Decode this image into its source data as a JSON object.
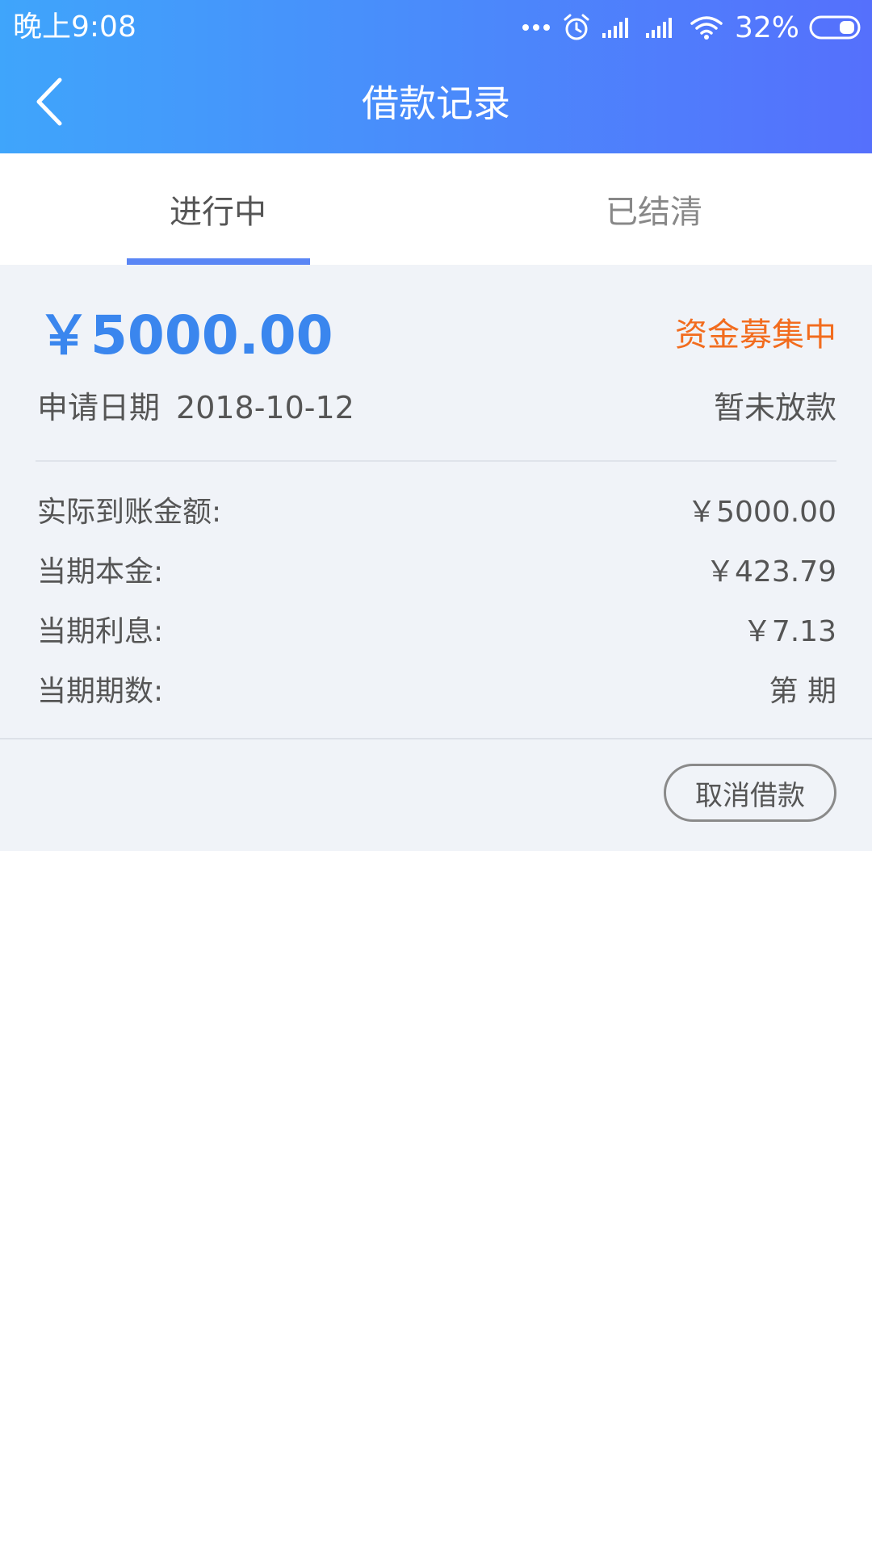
{
  "status_bar": {
    "time": "晚上9:08",
    "battery": "32%",
    "icons": [
      "more-dots-icon",
      "alarm-icon",
      "signal-icon",
      "signal-icon",
      "wifi-icon",
      "battery-icon"
    ]
  },
  "nav": {
    "title": "借款记录",
    "back_icon": "chevron-left-icon"
  },
  "tabs": [
    {
      "label": "进行中",
      "active": true
    },
    {
      "label": "已结清",
      "active": false
    }
  ],
  "loan": {
    "amount": "￥5000.00",
    "status": "资金募集中",
    "apply_date_label": "申请日期",
    "apply_date": "2018-10-12",
    "loan_state": "暂未放款",
    "details": [
      {
        "label": "实际到账金额:",
        "value": "￥5000.00"
      },
      {
        "label": "当期本金:",
        "value": "￥423.79"
      },
      {
        "label": "当期利息:",
        "value": "￥7.13"
      },
      {
        "label": "当期期数:",
        "value": "第 期"
      }
    ],
    "cancel_button": "取消借款"
  },
  "colors": {
    "header_start": "#3fa5fb",
    "header_end": "#5570fc",
    "amount": "#3a86ee",
    "status": "#f26c1e",
    "tab_indicator": "#5a86f5",
    "card_bg": "#f0f3f8"
  }
}
